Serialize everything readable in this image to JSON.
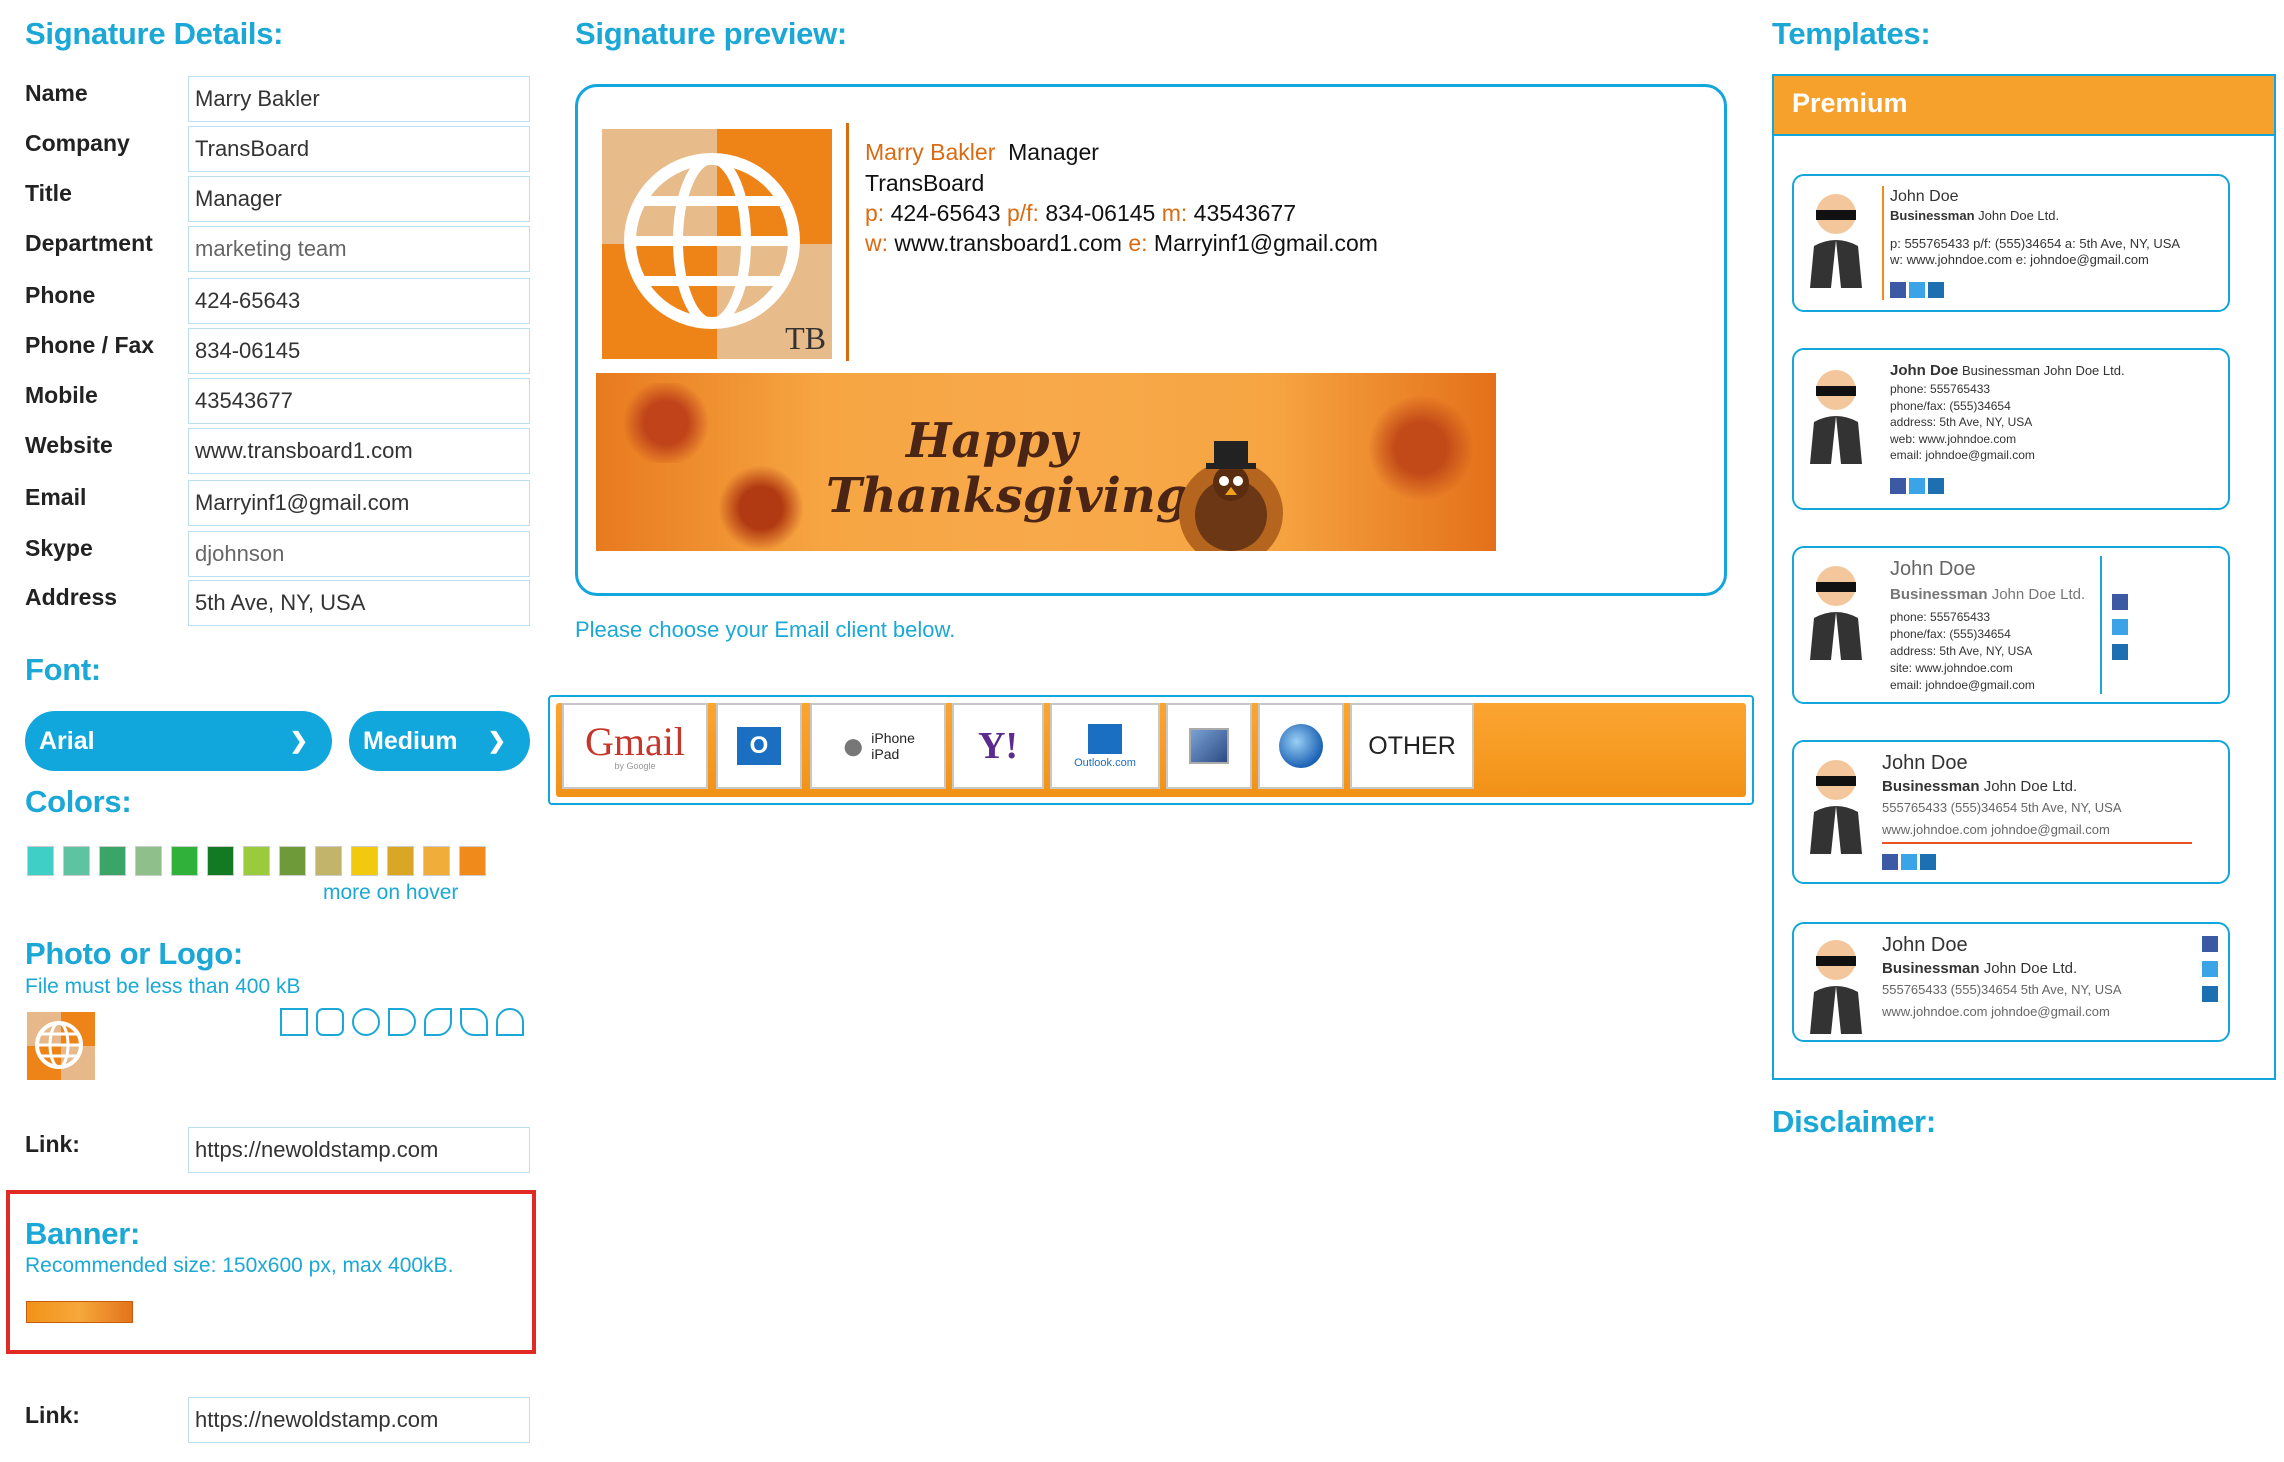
{
  "sections": {
    "signature_details": "Signature Details:",
    "signature_preview": "Signature preview:",
    "templates": "Templates:",
    "font": "Font:",
    "colors": "Colors:",
    "photo_logo": "Photo or Logo:",
    "banner": "Banner:",
    "disclaimer": "Disclaimer:"
  },
  "fields": [
    {
      "label": "Name",
      "value": "Marry Bakler"
    },
    {
      "label": "Company",
      "value": "TransBoard"
    },
    {
      "label": "Title",
      "value": "Manager"
    },
    {
      "label": "Department",
      "value": "marketing team"
    },
    {
      "label": "Phone",
      "value": "424-65643"
    },
    {
      "label": "Phone / Fax",
      "value": "834-06145"
    },
    {
      "label": "Mobile",
      "value": "43543677"
    },
    {
      "label": "Website",
      "value": "www.transboard1.com"
    },
    {
      "label": "Email",
      "value": "Marryinf1@gmail.com"
    },
    {
      "label": "Skype",
      "value": "djohnson"
    },
    {
      "label": "Address",
      "value": "5th Ave, NY, USA"
    }
  ],
  "font": {
    "family": "Arial",
    "size": "Medium"
  },
  "colors": {
    "swatches": [
      "#3fcfc7",
      "#5dc3a0",
      "#3aa567",
      "#8fbf8a",
      "#2fb13a",
      "#137a23",
      "#9acb3c",
      "#6f9a3a",
      "#c3b46b",
      "#f2c90c",
      "#d9a724",
      "#f0ad3a",
      "#f08a1a"
    ],
    "more_on_hover": "more on hover"
  },
  "photo": {
    "note": "File must be less than 400 kB",
    "link_label": "Link:",
    "link_value": "https://newoldstamp.com"
  },
  "banner": {
    "note": "Recommended size: 150x600 px, max 400kB.",
    "link_label": "Link:",
    "link_value": "https://newoldstamp.com"
  },
  "preview": {
    "name": "Marry Bakler",
    "title": "Manager",
    "company": "TransBoard",
    "phone_label": "p:",
    "phone": "424-65643",
    "fax_label": "p/f:",
    "fax": "834-06145",
    "mobile_label": "m:",
    "mobile": "43543677",
    "web_label": "w:",
    "web": "www.transboard1.com",
    "email_label": "e:",
    "email": "Marryinf1@gmail.com",
    "logo_text": "TB",
    "banner_line1": "Happy",
    "banner_line2": "Thanksgiving",
    "social": [
      "f",
      "t",
      "in",
      "p"
    ],
    "accent": "#d96b12"
  },
  "client_prompt": "Please choose your Email client below.",
  "clients": [
    {
      "name": "gmail",
      "label": "Gmail",
      "sub": "by Google"
    },
    {
      "name": "outlook",
      "label": "O"
    },
    {
      "name": "iphone",
      "label": "iPhone\niPad"
    },
    {
      "name": "yahoo",
      "label": "Y!"
    },
    {
      "name": "outlook-com",
      "label": "Outlook.com"
    },
    {
      "name": "apple-mail",
      "label": ""
    },
    {
      "name": "thunderbird",
      "label": ""
    },
    {
      "name": "other",
      "label": "OTHER"
    }
  ],
  "templates": {
    "header": "Premium",
    "cards": [
      {
        "name": "John Doe",
        "role": "Businessman",
        "company": "John Doe Ltd.",
        "lines": [
          "p: 555765433 p/f: (555)34654 a: 5th Ave, NY, USA",
          "w: www.johndoe.com e: johndoe@gmail.com"
        ]
      },
      {
        "name": "John Doe",
        "role": "Businessman",
        "company": "John Doe Ltd.",
        "lines": [
          "phone: 555765433",
          "phone/fax: (555)34654",
          "address: 5th Ave, NY, USA",
          "web: www.johndoe.com",
          "email: johndoe@gmail.com"
        ]
      },
      {
        "name": "John Doe",
        "role": "Businessman",
        "company": "John Doe Ltd.",
        "lines": [
          "phone: 555765433",
          "phone/fax: (555)34654",
          "address: 5th Ave, NY, USA",
          "site: www.johndoe.com",
          "email: johndoe@gmail.com"
        ]
      },
      {
        "name": "John Doe",
        "role": "Businessman",
        "company": "John Doe Ltd.",
        "lines": [
          "555765433 (555)34654 5th Ave, NY, USA",
          "www.johndoe.com johndoe@gmail.com"
        ]
      },
      {
        "name": "John Doe",
        "role": "Businessman",
        "company": "John Doe Ltd.",
        "lines": [
          "555765433 (555)34654 5th Ave, NY, USA",
          "www.johndoe.com johndoe@gmail.com"
        ]
      }
    ]
  }
}
